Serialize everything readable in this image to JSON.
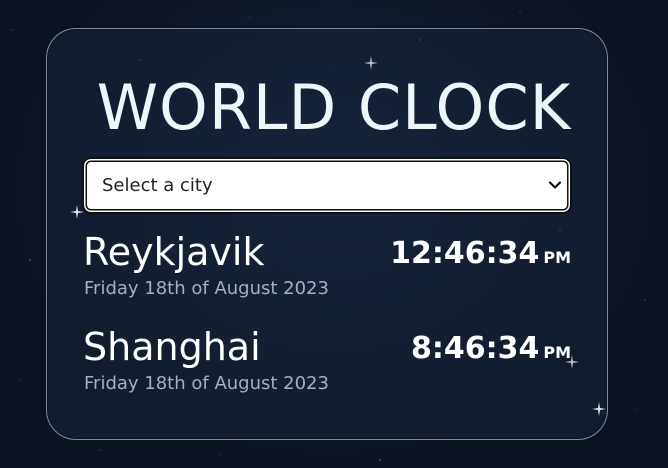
{
  "title": "WORLD CLOCK",
  "city_select": {
    "selected": "Select a city"
  },
  "cities": [
    {
      "name": "Reykjavik",
      "date": "Friday 18th of August 2023",
      "time": "12:46:34",
      "ampm": "PM"
    },
    {
      "name": "Shanghai",
      "date": "Friday 18th of August 2023",
      "time": "8:46:34",
      "ampm": "PM"
    }
  ],
  "colors": {
    "background": "#0b1220",
    "title": "#eef6f8",
    "date_text": "#a5b0bd"
  }
}
